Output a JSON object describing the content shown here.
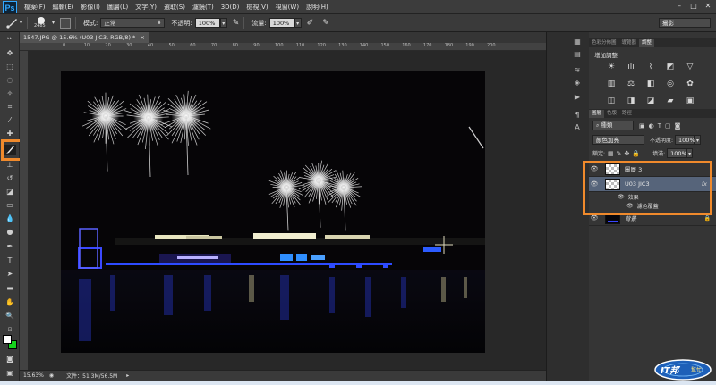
{
  "menubar": {
    "logo": "Ps",
    "items": [
      "檔案(F)",
      "編輯(E)",
      "影像(I)",
      "圖層(L)",
      "文字(Y)",
      "選取(S)",
      "濾鏡(T)",
      "3D(D)",
      "檢視(V)",
      "視窗(W)",
      "說明(H)"
    ],
    "controls": [
      "–",
      "□",
      "✕"
    ]
  },
  "options": {
    "brush_size": "2485",
    "mode_label": "模式:",
    "mode_value": "正常",
    "opacity_label": "不透明:",
    "opacity_value": "100%",
    "flow_label": "流量:",
    "flow_value": "100%",
    "workspace": "攝影"
  },
  "document": {
    "tab_title": "1547.JPG @ 15.6% (U03 JIC3, RGB/8) *",
    "close": "×",
    "status_zoom": "15.63%",
    "status_doc": "文件：51.3M/56.5M"
  },
  "ruler": {
    "ticks": [
      "0",
      "10",
      "20",
      "30",
      "40",
      "50",
      "60",
      "70",
      "80",
      "90",
      "100",
      "110",
      "120",
      "130",
      "140",
      "150",
      "160",
      "170",
      "180",
      "190",
      "200"
    ]
  },
  "panels": {
    "top_tabs": [
      "色彩分佈圖",
      "導覽器",
      "調整"
    ],
    "adjust_title": "增加調整",
    "layers_tabs": [
      "圖層",
      "色版",
      "路徑"
    ],
    "kind_label": "種類",
    "blend_value": "顏色加亮",
    "opacity_label": "不透明度:",
    "opacity_value": "100%",
    "lock_label": "鎖定:",
    "fill_label": "填滿:",
    "fill_value": "100%",
    "layers": [
      {
        "name": "圖層 3"
      },
      {
        "name": "U03 JIC3",
        "fx": "fx"
      },
      {
        "name": "效果"
      },
      {
        "name": "濾色覆蓋"
      },
      {
        "name": "背景"
      }
    ]
  },
  "watermark": {
    "text": "IT邦",
    "sub": "幫忙"
  }
}
